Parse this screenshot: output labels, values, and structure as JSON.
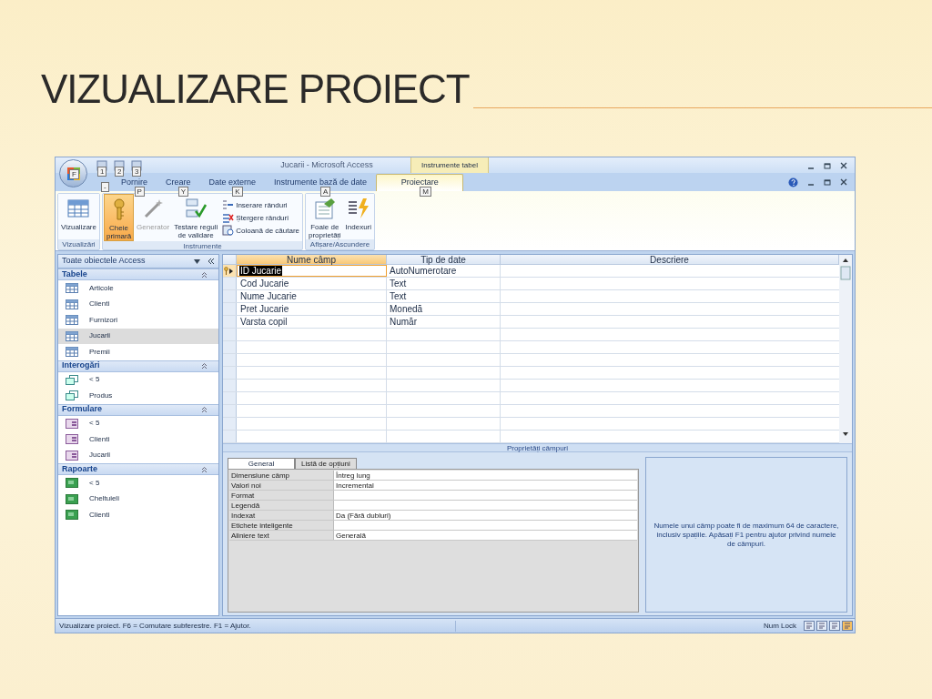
{
  "slide": {
    "title": "VIZUALIZARE PROIECT"
  },
  "window": {
    "title": "Jucarii - Microsoft Access",
    "context_group": "Instrumente tabel",
    "office_keytip": "F",
    "extra_keytip": "-",
    "quick_access": [
      {
        "keytip": "1"
      },
      {
        "keytip": "2"
      },
      {
        "keytip": "3"
      }
    ]
  },
  "ribbon_tabs": [
    {
      "label": "Pornire",
      "keytip": "P",
      "selected": false
    },
    {
      "label": "Creare",
      "keytip": "Y",
      "selected": false
    },
    {
      "label": "Date externe",
      "keytip": "K",
      "selected": false
    },
    {
      "label": "Instrumente bază de date",
      "keytip": "A",
      "selected": false
    },
    {
      "label": "Proiectare",
      "keytip": "M",
      "selected": true
    }
  ],
  "ribbon_groups": [
    {
      "label": "Vizualizări",
      "items": [
        {
          "kind": "large",
          "lines": [
            "Vizualizare"
          ],
          "selected": false,
          "disabled": false
        }
      ]
    },
    {
      "label": "Instrumente",
      "items": [
        {
          "kind": "large",
          "lines": [
            "Cheie",
            "primară"
          ],
          "selected": true,
          "disabled": false
        },
        {
          "kind": "large",
          "lines": [
            "Generator"
          ],
          "selected": false,
          "disabled": true
        },
        {
          "kind": "large",
          "lines": [
            "Testare reguli",
            "de validare"
          ],
          "selected": false,
          "disabled": false
        },
        {
          "kind": "small",
          "lines": [
            "Inserare rânduri"
          ],
          "selected": false,
          "disabled": false
        },
        {
          "kind": "small",
          "lines": [
            "Ștergere rânduri"
          ],
          "selected": false,
          "disabled": false
        },
        {
          "kind": "small",
          "lines": [
            "Coloană de căutare"
          ],
          "selected": false,
          "disabled": false
        }
      ]
    },
    {
      "label": "Afișare/Ascundere",
      "items": [
        {
          "kind": "large",
          "lines": [
            "Foaie de",
            "proprietăți"
          ],
          "selected": false,
          "disabled": false
        },
        {
          "kind": "large",
          "lines": [
            "Indexuri"
          ],
          "selected": false,
          "disabled": false
        }
      ]
    }
  ],
  "navigation": {
    "title": "Toate obiectele Access",
    "groups": [
      {
        "label": "Tabele",
        "kind": "table",
        "items": [
          {
            "label": "Articole",
            "selected": false
          },
          {
            "label": "Clienti",
            "selected": false
          },
          {
            "label": "Furnizori",
            "selected": false
          },
          {
            "label": "Jucarii",
            "selected": true
          },
          {
            "label": "Premii",
            "selected": false
          }
        ]
      },
      {
        "label": "Interogări",
        "kind": "query",
        "items": [
          {
            "label": "< 5",
            "selected": false
          },
          {
            "label": "Produs",
            "selected": false
          }
        ]
      },
      {
        "label": "Formulare",
        "kind": "form",
        "items": [
          {
            "label": "< 5",
            "selected": false
          },
          {
            "label": "Clienti",
            "selected": false
          },
          {
            "label": "Jucarii",
            "selected": false
          }
        ]
      },
      {
        "label": "Rapoarte",
        "kind": "report",
        "items": [
          {
            "label": "< 5",
            "selected": false
          },
          {
            "label": "Cheltuieli",
            "selected": false
          },
          {
            "label": "Clienti",
            "selected": false
          }
        ]
      }
    ]
  },
  "design_grid": {
    "columns": [
      "Nume câmp",
      "Tip de date",
      "Descriere"
    ],
    "rows": [
      {
        "name": "ID Jucarie",
        "type": "AutoNumerotare",
        "selected": true,
        "primary_key": true
      },
      {
        "name": "Cod Jucarie",
        "type": "Text",
        "selected": false,
        "primary_key": false
      },
      {
        "name": "Nume Jucarie",
        "type": "Text",
        "selected": false,
        "primary_key": false
      },
      {
        "name": "Pret Jucarie",
        "type": "Monedă",
        "selected": false,
        "primary_key": false
      },
      {
        "name": "Varsta copil",
        "type": "Număr",
        "selected": false,
        "primary_key": false
      }
    ]
  },
  "field_properties": {
    "label": "Proprietăți câmpuri",
    "tabs": [
      {
        "label": "General",
        "selected": true
      },
      {
        "label": "Listă de opțiuni",
        "selected": false
      }
    ],
    "rows": [
      {
        "label": "Dimensiune câmp",
        "value": "Întreg lung"
      },
      {
        "label": "Valori noi",
        "value": "Incremental"
      },
      {
        "label": "Format"
      },
      {
        "label": "Legendă"
      },
      {
        "label": "Indexat",
        "value": "Da (Fără dubluri)"
      },
      {
        "label": "Etichete inteligente"
      },
      {
        "label": "Aliniere text",
        "value": "Generală"
      }
    ],
    "help": "Numele unui câmp poate fi de maximum 64 de caractere, inclusiv spațiile.  Apăsați F1 pentru ajutor privind numele de câmpuri."
  },
  "status_bar": {
    "text": "Vizualizare proiect.  F6 = Comutare subferestre.  F1 = Ajutor.",
    "indicator": "Num Lock"
  }
}
